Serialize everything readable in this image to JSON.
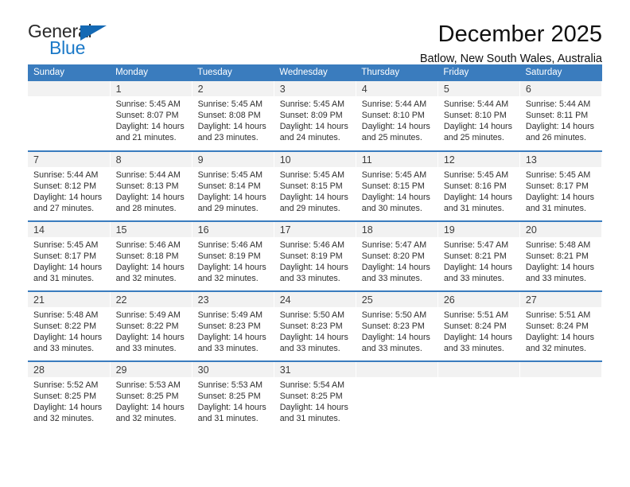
{
  "logo": {
    "word_one": "General",
    "word_two": "Blue",
    "triangle_color": "#1469b4",
    "blue_color": "#1b79c8"
  },
  "header": {
    "month_title": "December 2025",
    "location": "Batlow, New South Wales, Australia"
  },
  "theme": {
    "header_bg": "#3a7cbe",
    "daynum_bg": "#f2f2f2",
    "row_divider": "#3a7cbe"
  },
  "calendar": {
    "weekday_headers": [
      "Sunday",
      "Monday",
      "Tuesday",
      "Wednesday",
      "Thursday",
      "Friday",
      "Saturday"
    ],
    "weeks": [
      [
        {
          "day": "",
          "sunrise": "",
          "sunset": "",
          "daylight_line1": "",
          "daylight_line2": ""
        },
        {
          "day": "1",
          "sunrise": "Sunrise: 5:45 AM",
          "sunset": "Sunset: 8:07 PM",
          "daylight_line1": "Daylight: 14 hours",
          "daylight_line2": "and 21 minutes."
        },
        {
          "day": "2",
          "sunrise": "Sunrise: 5:45 AM",
          "sunset": "Sunset: 8:08 PM",
          "daylight_line1": "Daylight: 14 hours",
          "daylight_line2": "and 23 minutes."
        },
        {
          "day": "3",
          "sunrise": "Sunrise: 5:45 AM",
          "sunset": "Sunset: 8:09 PM",
          "daylight_line1": "Daylight: 14 hours",
          "daylight_line2": "and 24 minutes."
        },
        {
          "day": "4",
          "sunrise": "Sunrise: 5:44 AM",
          "sunset": "Sunset: 8:10 PM",
          "daylight_line1": "Daylight: 14 hours",
          "daylight_line2": "and 25 minutes."
        },
        {
          "day": "5",
          "sunrise": "Sunrise: 5:44 AM",
          "sunset": "Sunset: 8:10 PM",
          "daylight_line1": "Daylight: 14 hours",
          "daylight_line2": "and 25 minutes."
        },
        {
          "day": "6",
          "sunrise": "Sunrise: 5:44 AM",
          "sunset": "Sunset: 8:11 PM",
          "daylight_line1": "Daylight: 14 hours",
          "daylight_line2": "and 26 minutes."
        }
      ],
      [
        {
          "day": "7",
          "sunrise": "Sunrise: 5:44 AM",
          "sunset": "Sunset: 8:12 PM",
          "daylight_line1": "Daylight: 14 hours",
          "daylight_line2": "and 27 minutes."
        },
        {
          "day": "8",
          "sunrise": "Sunrise: 5:44 AM",
          "sunset": "Sunset: 8:13 PM",
          "daylight_line1": "Daylight: 14 hours",
          "daylight_line2": "and 28 minutes."
        },
        {
          "day": "9",
          "sunrise": "Sunrise: 5:45 AM",
          "sunset": "Sunset: 8:14 PM",
          "daylight_line1": "Daylight: 14 hours",
          "daylight_line2": "and 29 minutes."
        },
        {
          "day": "10",
          "sunrise": "Sunrise: 5:45 AM",
          "sunset": "Sunset: 8:15 PM",
          "daylight_line1": "Daylight: 14 hours",
          "daylight_line2": "and 29 minutes."
        },
        {
          "day": "11",
          "sunrise": "Sunrise: 5:45 AM",
          "sunset": "Sunset: 8:15 PM",
          "daylight_line1": "Daylight: 14 hours",
          "daylight_line2": "and 30 minutes."
        },
        {
          "day": "12",
          "sunrise": "Sunrise: 5:45 AM",
          "sunset": "Sunset: 8:16 PM",
          "daylight_line1": "Daylight: 14 hours",
          "daylight_line2": "and 31 minutes."
        },
        {
          "day": "13",
          "sunrise": "Sunrise: 5:45 AM",
          "sunset": "Sunset: 8:17 PM",
          "daylight_line1": "Daylight: 14 hours",
          "daylight_line2": "and 31 minutes."
        }
      ],
      [
        {
          "day": "14",
          "sunrise": "Sunrise: 5:45 AM",
          "sunset": "Sunset: 8:17 PM",
          "daylight_line1": "Daylight: 14 hours",
          "daylight_line2": "and 31 minutes."
        },
        {
          "day": "15",
          "sunrise": "Sunrise: 5:46 AM",
          "sunset": "Sunset: 8:18 PM",
          "daylight_line1": "Daylight: 14 hours",
          "daylight_line2": "and 32 minutes."
        },
        {
          "day": "16",
          "sunrise": "Sunrise: 5:46 AM",
          "sunset": "Sunset: 8:19 PM",
          "daylight_line1": "Daylight: 14 hours",
          "daylight_line2": "and 32 minutes."
        },
        {
          "day": "17",
          "sunrise": "Sunrise: 5:46 AM",
          "sunset": "Sunset: 8:19 PM",
          "daylight_line1": "Daylight: 14 hours",
          "daylight_line2": "and 33 minutes."
        },
        {
          "day": "18",
          "sunrise": "Sunrise: 5:47 AM",
          "sunset": "Sunset: 8:20 PM",
          "daylight_line1": "Daylight: 14 hours",
          "daylight_line2": "and 33 minutes."
        },
        {
          "day": "19",
          "sunrise": "Sunrise: 5:47 AM",
          "sunset": "Sunset: 8:21 PM",
          "daylight_line1": "Daylight: 14 hours",
          "daylight_line2": "and 33 minutes."
        },
        {
          "day": "20",
          "sunrise": "Sunrise: 5:48 AM",
          "sunset": "Sunset: 8:21 PM",
          "daylight_line1": "Daylight: 14 hours",
          "daylight_line2": "and 33 minutes."
        }
      ],
      [
        {
          "day": "21",
          "sunrise": "Sunrise: 5:48 AM",
          "sunset": "Sunset: 8:22 PM",
          "daylight_line1": "Daylight: 14 hours",
          "daylight_line2": "and 33 minutes."
        },
        {
          "day": "22",
          "sunrise": "Sunrise: 5:49 AM",
          "sunset": "Sunset: 8:22 PM",
          "daylight_line1": "Daylight: 14 hours",
          "daylight_line2": "and 33 minutes."
        },
        {
          "day": "23",
          "sunrise": "Sunrise: 5:49 AM",
          "sunset": "Sunset: 8:23 PM",
          "daylight_line1": "Daylight: 14 hours",
          "daylight_line2": "and 33 minutes."
        },
        {
          "day": "24",
          "sunrise": "Sunrise: 5:50 AM",
          "sunset": "Sunset: 8:23 PM",
          "daylight_line1": "Daylight: 14 hours",
          "daylight_line2": "and 33 minutes."
        },
        {
          "day": "25",
          "sunrise": "Sunrise: 5:50 AM",
          "sunset": "Sunset: 8:23 PM",
          "daylight_line1": "Daylight: 14 hours",
          "daylight_line2": "and 33 minutes."
        },
        {
          "day": "26",
          "sunrise": "Sunrise: 5:51 AM",
          "sunset": "Sunset: 8:24 PM",
          "daylight_line1": "Daylight: 14 hours",
          "daylight_line2": "and 33 minutes."
        },
        {
          "day": "27",
          "sunrise": "Sunrise: 5:51 AM",
          "sunset": "Sunset: 8:24 PM",
          "daylight_line1": "Daylight: 14 hours",
          "daylight_line2": "and 32 minutes."
        }
      ],
      [
        {
          "day": "28",
          "sunrise": "Sunrise: 5:52 AM",
          "sunset": "Sunset: 8:25 PM",
          "daylight_line1": "Daylight: 14 hours",
          "daylight_line2": "and 32 minutes."
        },
        {
          "day": "29",
          "sunrise": "Sunrise: 5:53 AM",
          "sunset": "Sunset: 8:25 PM",
          "daylight_line1": "Daylight: 14 hours",
          "daylight_line2": "and 32 minutes."
        },
        {
          "day": "30",
          "sunrise": "Sunrise: 5:53 AM",
          "sunset": "Sunset: 8:25 PM",
          "daylight_line1": "Daylight: 14 hours",
          "daylight_line2": "and 31 minutes."
        },
        {
          "day": "31",
          "sunrise": "Sunrise: 5:54 AM",
          "sunset": "Sunset: 8:25 PM",
          "daylight_line1": "Daylight: 14 hours",
          "daylight_line2": "and 31 minutes."
        },
        {
          "day": "",
          "sunrise": "",
          "sunset": "",
          "daylight_line1": "",
          "daylight_line2": ""
        },
        {
          "day": "",
          "sunrise": "",
          "sunset": "",
          "daylight_line1": "",
          "daylight_line2": ""
        },
        {
          "day": "",
          "sunrise": "",
          "sunset": "",
          "daylight_line1": "",
          "daylight_line2": ""
        }
      ]
    ]
  }
}
